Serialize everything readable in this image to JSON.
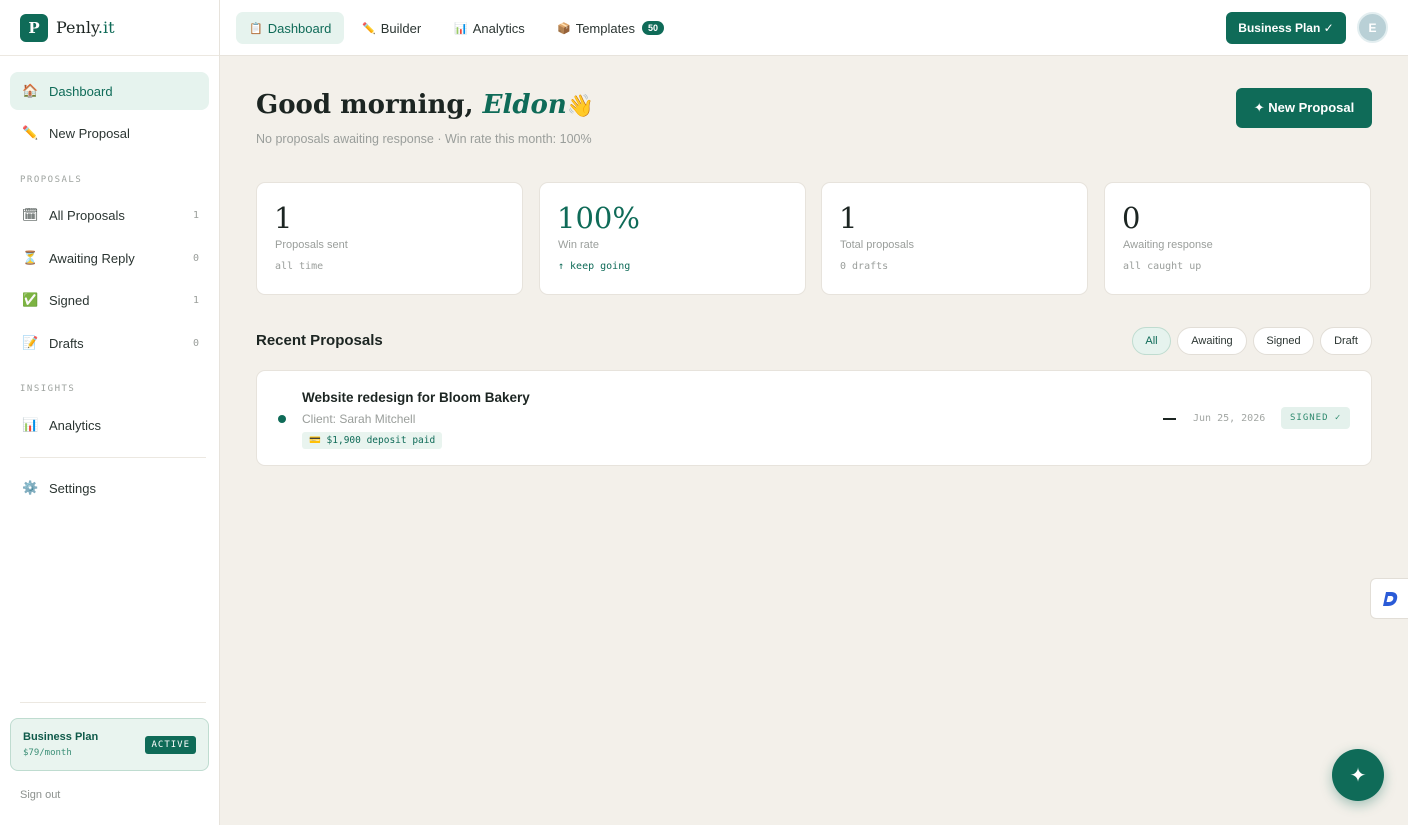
{
  "brand": {
    "logo_letter": "P",
    "name_main": "Penly",
    "name_accent": ".it"
  },
  "sidebar": {
    "top_items": [
      {
        "icon": "🏠",
        "label": "Dashboard"
      },
      {
        "icon": "✏️",
        "label": "New Proposal"
      }
    ],
    "proposals_section": {
      "label": "PROPOSALS",
      "items": [
        {
          "icon": "🗓",
          "label": "All Proposals",
          "count": "1"
        },
        {
          "icon": "⏳",
          "label": "Awaiting Reply",
          "count": "0"
        },
        {
          "icon": "✅",
          "label": "Signed",
          "count": "1"
        },
        {
          "icon": "📝",
          "label": "Drafts",
          "count": "0"
        }
      ]
    },
    "insights_section": {
      "label": "INSIGHTS",
      "items": [
        {
          "icon": "📊",
          "label": "Analytics"
        }
      ]
    },
    "settings": {
      "icon": "⚙️",
      "label": "Settings"
    },
    "plan": {
      "name": "Business Plan",
      "price": "$79/month",
      "badge": "ACTIVE"
    },
    "sign_out": "Sign out"
  },
  "topbar": {
    "tabs": [
      {
        "icon": "📋",
        "label": "Dashboard"
      },
      {
        "icon": "✏️",
        "label": "Builder"
      },
      {
        "icon": "📊",
        "label": "Analytics"
      },
      {
        "icon": "📦",
        "label": "Templates",
        "badge": "50"
      }
    ],
    "plan_button": "Business Plan ✓",
    "avatar_initial": "E"
  },
  "main": {
    "greeting_prefix": "Good morning, ",
    "greeting_name": "Eldon",
    "greeting_emoji": "👋",
    "subtitle": "No proposals awaiting response · Win rate this month: 100%",
    "new_proposal_button": "✦ New Proposal",
    "stats": [
      {
        "value": "1",
        "label": "Proposals sent",
        "note": "all time"
      },
      {
        "value": "100%",
        "label": "Win rate",
        "note": "↑ keep going"
      },
      {
        "value": "1",
        "label": "Total proposals",
        "note": "0 drafts"
      },
      {
        "value": "0",
        "label": "Awaiting response",
        "note": "all caught up"
      }
    ],
    "recent_title": "Recent Proposals",
    "filters": [
      "All",
      "Awaiting",
      "Signed",
      "Draft"
    ],
    "proposals": [
      {
        "title": "Website redesign for Bloom Bakery",
        "client": "Client: Sarah Mitchell",
        "deposit": "💳 $1,900 deposit paid",
        "date": "Jun 25, 2026",
        "status": "SIGNED ✓"
      }
    ]
  },
  "widgets": {
    "side_widget_letter": "D",
    "fab_icon": "✦"
  },
  "colors": {
    "accent": "#0f6b58",
    "accent_light": "#e6f3ee",
    "background": "#f3f0ea"
  }
}
